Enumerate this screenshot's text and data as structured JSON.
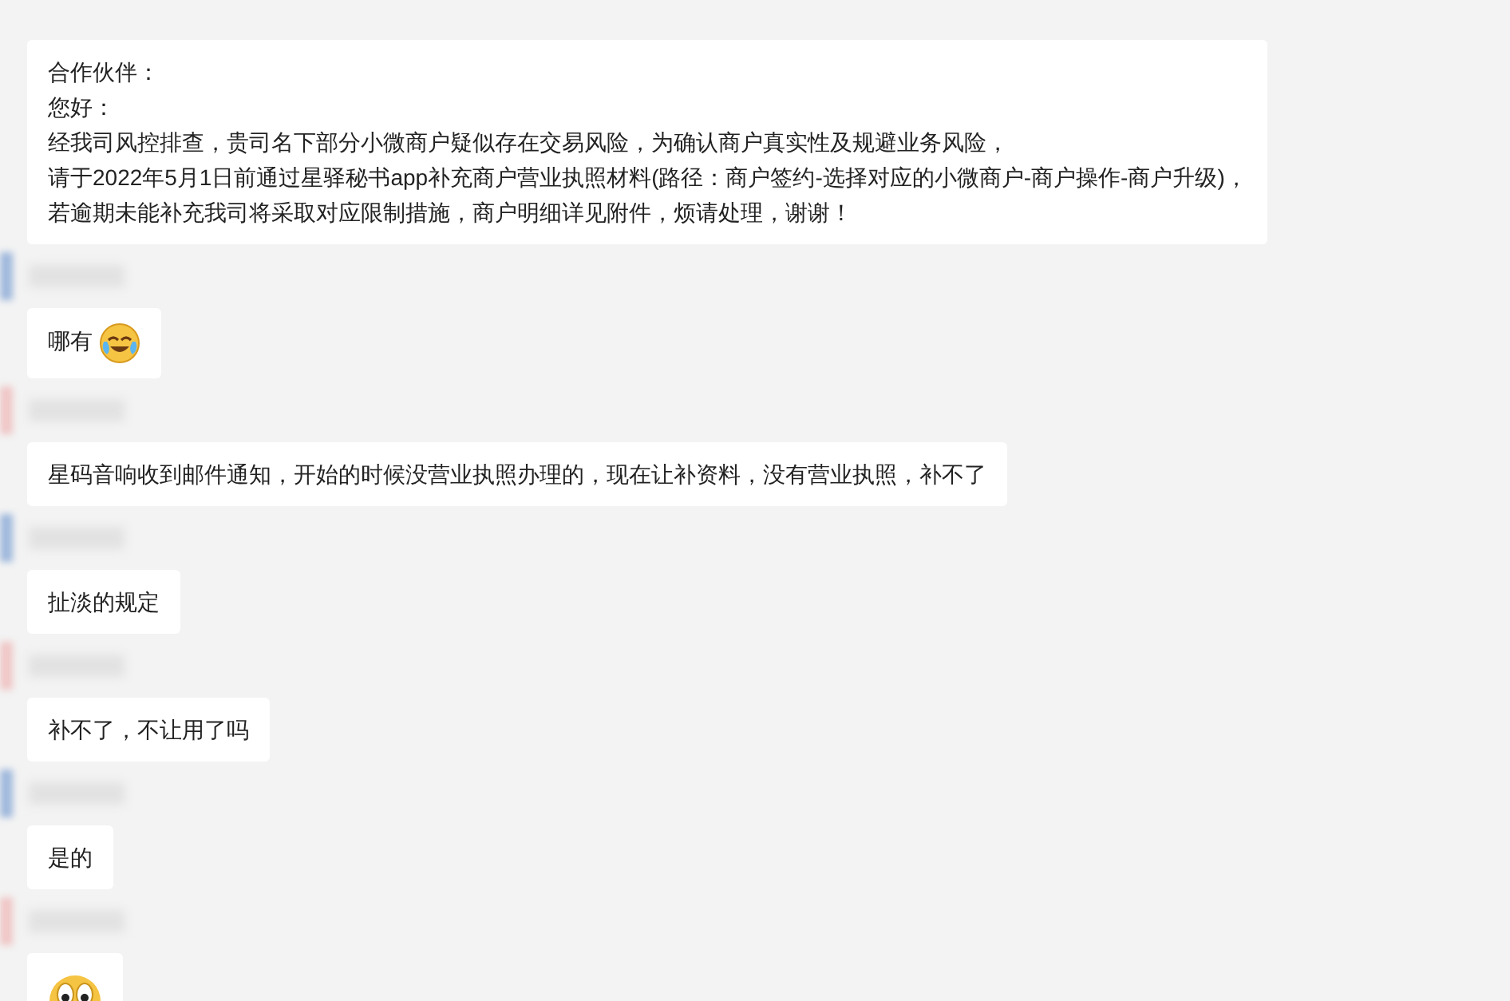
{
  "messages": [
    {
      "kind": "text",
      "lines": [
        "合作伙伴：",
        "您好：",
        "经我司风控排查，贵司名下部分小微商户疑似存在交易风险，为确认商户真实性及规避业务风险，",
        "请于2022年5月1日前通过星驿秘书app补充商户营业执照材料(路径：商户签约-选择对应的小微商户-商户操作-商户升级)，",
        "若逾期未能补充我司将采取对应限制措施，商户明细详见附件，烦请处理，谢谢！"
      ]
    },
    {
      "kind": "text_emoji",
      "lines": [
        "哪有"
      ]
    },
    {
      "kind": "text",
      "lines": [
        "星码音响收到邮件通知，开始的时候没营业执照办理的，现在让补资料，没有营业执照，补不了"
      ]
    },
    {
      "kind": "text",
      "lines": [
        "扯淡的规定"
      ]
    },
    {
      "kind": "text",
      "lines": [
        "补不了，不让用了吗"
      ]
    },
    {
      "kind": "text",
      "lines": [
        "是的"
      ]
    },
    {
      "kind": "emoji"
    }
  ]
}
